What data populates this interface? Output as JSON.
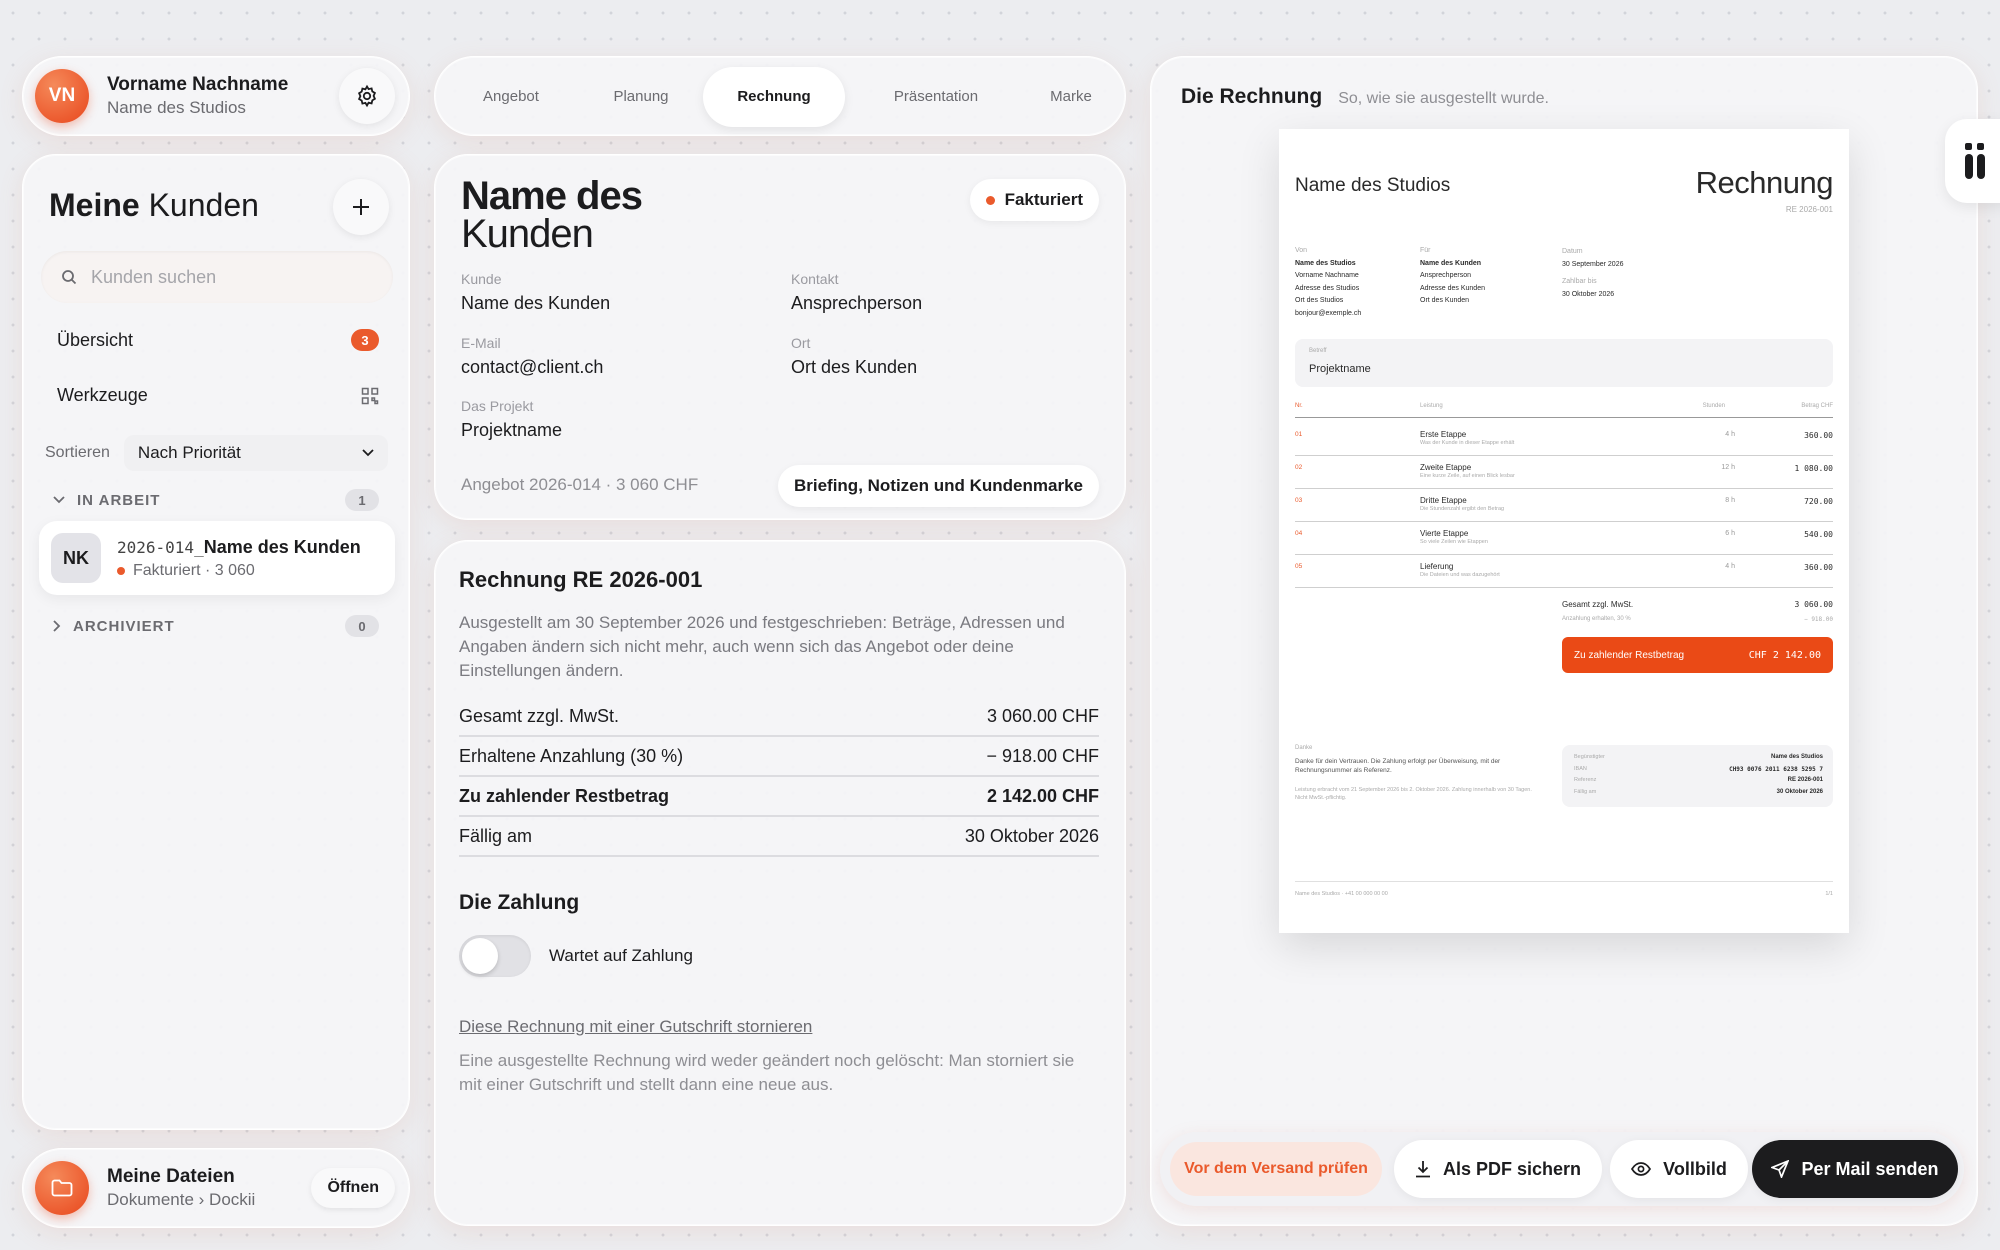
{
  "profile": {
    "initials": "VN",
    "name": "Vorname Nachname",
    "studio": "Name des Studios"
  },
  "tabs": [
    "Angebot",
    "Planung",
    "Rechnung",
    "Präsentation",
    "Marke"
  ],
  "sidebar": {
    "title_bold": "Meine",
    "title_rest": "Kunden",
    "search_placeholder": "Kunden suchen",
    "overview": "Übersicht",
    "overview_count": "3",
    "tools": "Werkzeuge",
    "sort_label": "Sortieren",
    "sort_value": "Nach Priorität",
    "in_progress": "IN ARBEIT",
    "in_progress_count": "1",
    "client_initials": "NK",
    "client_code": "2026-014_",
    "client_name": "Name des Kunden",
    "client_status": "Fakturiert · 3 060",
    "archived": "ARCHIVIERT",
    "archived_count": "0"
  },
  "files": {
    "title": "Meine Dateien",
    "path": "Dokumente › Dockii",
    "open": "Öffnen"
  },
  "client": {
    "title_line1": "Name des",
    "title_line2": "Kunden",
    "status": "Fakturiert",
    "fields": [
      {
        "label": "Kunde",
        "value": "Name des Kunden"
      },
      {
        "label": "Kontakt",
        "value": "Ansprechperson"
      },
      {
        "label": "E-Mail",
        "value": "contact@client.ch"
      },
      {
        "label": "Ort",
        "value": "Ort des Kunden"
      },
      {
        "label": "Das Projekt",
        "value": "Projektname"
      }
    ],
    "offer": "Angebot 2026-014 · 3 060 CHF",
    "briefing": "Briefing, Notizen und Kundenmarke"
  },
  "invoice": {
    "title": "Rechnung RE 2026-001",
    "description": "Ausgestellt am 30 September 2026 und festgeschrieben: Beträge, Adressen und Angaben ändern sich nicht mehr, auch wenn sich das Angebot oder deine Einstellungen ändern.",
    "rows": [
      {
        "label": "Gesamt zzgl. MwSt.",
        "value": "3 060.00 CHF"
      },
      {
        "label": "Erhaltene Anzahlung (30 %)",
        "value": "− 918.00 CHF"
      },
      {
        "label": "Zu zahlender Restbetrag",
        "value": "2 142.00 CHF"
      },
      {
        "label": "Fällig am",
        "value": "30 Oktober 2026"
      }
    ],
    "payment_title": "Die Zahlung",
    "payment_status": "Wartet auf Zahlung",
    "cancel_link": "Diese Rechnung mit einer Gutschrift stornieren",
    "cancel_note": "Eine ausgestellte Rechnung wird weder geändert noch gelöscht: Man storniert sie mit einer Gutschrift und stellt dann eine neue aus."
  },
  "preview": {
    "title": "Die Rechnung",
    "subtitle": "So, wie sie ausgestellt wurde.",
    "doc": {
      "studio": "Name des Studios",
      "heading": "Rechnung",
      "number": "RE 2026-001",
      "from_label": "Von",
      "from_lines": [
        "Name des Studios",
        "Vorname Nachname",
        "Adresse des Studios",
        "Ort des Studios",
        "bonjour@exemple.ch"
      ],
      "to_label": "Für",
      "to_lines": [
        "Name des Kunden",
        "Ansprechperson",
        "Adresse des Kunden",
        "Ort des Kunden"
      ],
      "date_label": "Datum",
      "date": "30 September 2026",
      "due_label": "Zahlbar bis",
      "due": "30 Oktober 2026",
      "subject_label": "Betreff",
      "subject": "Projektname",
      "col_nr": "Nr.",
      "col_service": "Leistung",
      "col_hours": "Stunden",
      "col_amount": "Betrag CHF",
      "items": [
        {
          "nr": "01",
          "name": "Erste Etappe",
          "desc": "Was der Kunde in dieser Etappe erhält",
          "hours": "4 h",
          "amount": "360.00"
        },
        {
          "nr": "02",
          "name": "Zweite Etappe",
          "desc": "Eine kurze Zeile, auf einen Blick lesbar",
          "hours": "12 h",
          "amount": "1 080.00"
        },
        {
          "nr": "03",
          "name": "Dritte Etappe",
          "desc": "Die Stundenzahl ergibt den Betrag",
          "hours": "8 h",
          "amount": "720.00"
        },
        {
          "nr": "04",
          "name": "Vierte Etappe",
          "desc": "So viele Zeilen wie Etappen",
          "hours": "6 h",
          "amount": "540.00"
        },
        {
          "nr": "05",
          "name": "Lieferung",
          "desc": "Die Dateien und was dazugehört",
          "hours": "4 h",
          "amount": "360.00"
        }
      ],
      "total_label": "Gesamt zzgl. MwSt.",
      "total": "3 060.00",
      "deposit_label": "Anzahlung erhalten, 30 %",
      "deposit": "− 918.00",
      "due_amount_label": "Zu zahlender Restbetrag",
      "due_amount": "CHF 2 142.00",
      "thanks_label": "Danke",
      "thanks_text": "Danke für dein Vertrauen. Die Zahlung erfolgt per Überweisung, mit der Rechnungsnummer als Referenz.",
      "service_note": "Leistung erbracht vom 21 September 2026 bis 2. Oktober 2026. Zahlung innerhalb von 30 Tagen. Nicht MwSt.-pflichtig.",
      "pay_labels": [
        "Begünstigter",
        "IBAN",
        "Referenz",
        "Fällig am"
      ],
      "pay_values": [
        "Name des Studios",
        "CH93 0076 2011 6238 5295 7",
        "RE 2026-001",
        "30 Oktober 2026"
      ],
      "footer_left": "Name des Studios · +41 00 000 00 00",
      "footer_right": "1/1"
    },
    "check": "Vor dem Versand prüfen",
    "pdf": "Als PDF sichern",
    "fullview": "Vollbild",
    "send": "Per Mail senden"
  },
  "colors": {
    "accent": "#ea5a2c",
    "dark": "#1c1c1e"
  }
}
